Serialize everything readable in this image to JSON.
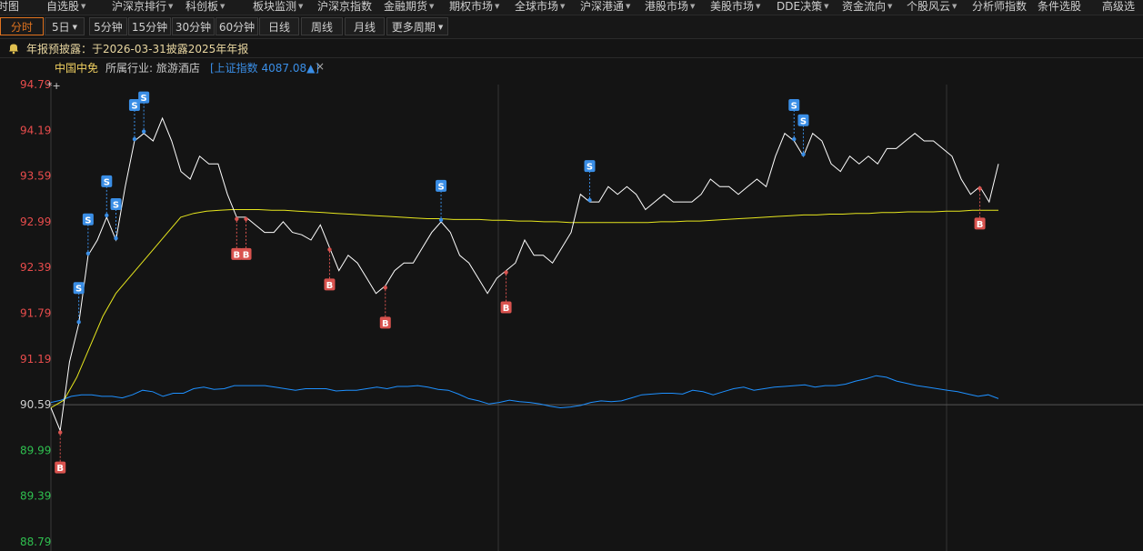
{
  "menubar": {
    "items": [
      {
        "label": "时图",
        "arrow": false
      },
      {
        "label": "自选股",
        "arrow": true
      },
      {
        "label": "沪深京排行",
        "arrow": true
      },
      {
        "label": "科创板",
        "arrow": true
      },
      {
        "label": "板块监测",
        "arrow": true
      },
      {
        "label": "沪深京指数",
        "arrow": false
      },
      {
        "label": "金融期货",
        "arrow": true
      },
      {
        "label": "期权市场",
        "arrow": true
      },
      {
        "label": "全球市场",
        "arrow": true
      },
      {
        "label": "沪深港通",
        "arrow": true
      },
      {
        "label": "港股市场",
        "arrow": true
      },
      {
        "label": "美股市场",
        "arrow": true
      },
      {
        "label": "DDE决策",
        "arrow": true
      },
      {
        "label": "资金流向",
        "arrow": true
      },
      {
        "label": "个股风云",
        "arrow": true
      },
      {
        "label": "分析师指数",
        "arrow": false
      },
      {
        "label": "条件选股",
        "arrow": false
      },
      {
        "label": "高级选",
        "arrow": false
      }
    ]
  },
  "tabs": [
    {
      "label": "分时",
      "active": true,
      "arrow": false
    },
    {
      "label": "5日",
      "active": false,
      "arrow": true
    },
    {
      "label": "5分钟",
      "active": false,
      "arrow": false
    },
    {
      "label": "15分钟",
      "active": false,
      "arrow": false
    },
    {
      "label": "30分钟",
      "active": false,
      "arrow": false
    },
    {
      "label": "60分钟",
      "active": false,
      "arrow": false
    },
    {
      "label": "日线",
      "active": false,
      "arrow": false
    },
    {
      "label": "周线",
      "active": false,
      "arrow": false
    },
    {
      "label": "月线",
      "active": false,
      "arrow": false
    },
    {
      "label": "更多周期",
      "active": false,
      "arrow": true
    }
  ],
  "notice": {
    "text": "年报预披露：于2026-03-31披露2025年年报",
    "icon": "bell-icon"
  },
  "info": {
    "stock_name": "中国中免",
    "industry": "所属行业: 旅游酒店",
    "index_label": "[上证指数 4087.08▲]",
    "close": "×"
  },
  "colors": {
    "price_line": "#ffffff",
    "avg_line": "#e6e61e",
    "index_line": "#1e90ff",
    "up_axis": "#e84c4c",
    "down_axis": "#2fbf4f",
    "base_axis": "#cfcfcf",
    "buy_marker": "#d9534f",
    "sell_marker": "#3a8ee6"
  },
  "chart_data": {
    "type": "line",
    "y_ticks": [
      "94.79",
      "94.19",
      "93.59",
      "92.99",
      "92.39",
      "91.79",
      "91.19",
      "90.59",
      "89.99",
      "89.39",
      "88.79"
    ],
    "ylim": [
      88.79,
      94.79
    ],
    "base_value": 90.59,
    "series": [],
    "price": [
      90.55,
      90.25,
      91.15,
      91.65,
      92.55,
      92.75,
      93.05,
      92.75,
      93.45,
      94.05,
      94.15,
      94.05,
      94.35,
      94.05,
      93.65,
      93.55,
      93.85,
      93.75,
      93.75,
      93.35,
      93.05,
      93.05,
      92.95,
      92.85,
      92.85,
      92.99,
      92.85,
      92.82,
      92.75,
      92.95,
      92.65,
      92.35,
      92.55,
      92.45,
      92.25,
      92.05,
      92.15,
      92.35,
      92.45,
      92.45,
      92.65,
      92.85,
      92.99,
      92.85,
      92.55,
      92.45,
      92.25,
      92.05,
      92.25,
      92.35,
      92.45,
      92.75,
      92.55,
      92.55,
      92.45,
      92.65,
      92.85,
      93.35,
      93.25,
      93.25,
      93.45,
      93.35,
      93.45,
      93.35,
      93.15,
      93.25,
      93.35,
      93.25,
      93.25,
      93.25,
      93.35,
      93.55,
      93.45,
      93.45,
      93.35,
      93.45,
      93.55,
      93.45,
      93.85,
      94.15,
      94.05,
      93.85,
      94.15,
      94.05,
      93.75,
      93.65,
      93.85,
      93.75,
      93.85,
      93.75,
      93.95,
      93.95,
      94.05,
      94.15,
      94.05,
      94.05,
      93.95,
      93.85,
      93.55,
      93.35,
      93.45,
      93.25,
      93.75
    ],
    "avg": [
      90.55,
      90.65,
      90.95,
      91.35,
      91.75,
      92.05,
      92.25,
      92.45,
      92.65,
      92.85,
      93.05,
      93.1,
      93.13,
      93.14,
      93.15,
      93.15,
      93.15,
      93.14,
      93.14,
      93.13,
      93.12,
      93.11,
      93.1,
      93.09,
      93.08,
      93.07,
      93.06,
      93.05,
      93.04,
      93.03,
      93.03,
      93.02,
      93.02,
      93.02,
      93.01,
      93.01,
      93.0,
      93.0,
      92.99,
      92.99,
      92.98,
      92.98,
      92.98,
      92.98,
      92.98,
      92.98,
      92.98,
      92.99,
      92.99,
      93.0,
      93.0,
      93.01,
      93.02,
      93.03,
      93.04,
      93.05,
      93.06,
      93.07,
      93.08,
      93.08,
      93.09,
      93.09,
      93.1,
      93.1,
      93.11,
      93.11,
      93.12,
      93.12,
      93.12,
      93.13,
      93.13,
      93.14,
      93.14,
      93.14
    ],
    "index": [
      90.62,
      90.65,
      90.7,
      90.72,
      90.72,
      90.7,
      90.7,
      90.68,
      90.72,
      90.78,
      90.76,
      90.7,
      90.74,
      90.74,
      90.8,
      90.82,
      90.79,
      90.8,
      90.84,
      90.84,
      90.84,
      90.84,
      90.82,
      90.8,
      90.78,
      90.8,
      90.8,
      90.8,
      90.77,
      90.78,
      90.78,
      90.8,
      90.82,
      90.8,
      90.83,
      90.83,
      90.84,
      90.82,
      90.79,
      90.78,
      90.73,
      90.67,
      90.64,
      90.6,
      90.62,
      90.65,
      90.63,
      90.62,
      90.6,
      90.57,
      90.55,
      90.56,
      90.58,
      90.62,
      90.64,
      90.63,
      90.64,
      90.68,
      90.72,
      90.73,
      90.74,
      90.74,
      90.73,
      90.78,
      90.76,
      90.72,
      90.76,
      90.8,
      90.82,
      90.78,
      90.8,
      90.82,
      90.83,
      90.84,
      90.85,
      90.82,
      90.84,
      90.84,
      90.86,
      90.9,
      90.93,
      90.97,
      90.95,
      90.9,
      90.87,
      90.84,
      90.82,
      90.8,
      90.78,
      90.76,
      90.73,
      90.7,
      90.72,
      90.67
    ],
    "sell_signals": [
      {
        "x": 3
      },
      {
        "x": 4
      },
      {
        "x": 6
      },
      {
        "x": 7
      },
      {
        "x": 9
      },
      {
        "x": 10
      },
      {
        "x": 42
      },
      {
        "x": 58
      },
      {
        "x": 80
      },
      {
        "x": 81
      }
    ],
    "buy_signals": [
      {
        "x": 1
      },
      {
        "x": 20
      },
      {
        "x": 21
      },
      {
        "x": 30
      },
      {
        "x": 36
      },
      {
        "x": 49
      },
      {
        "x": 100
      }
    ],
    "signal_labels": {
      "buy": "B",
      "sell": "S"
    }
  }
}
